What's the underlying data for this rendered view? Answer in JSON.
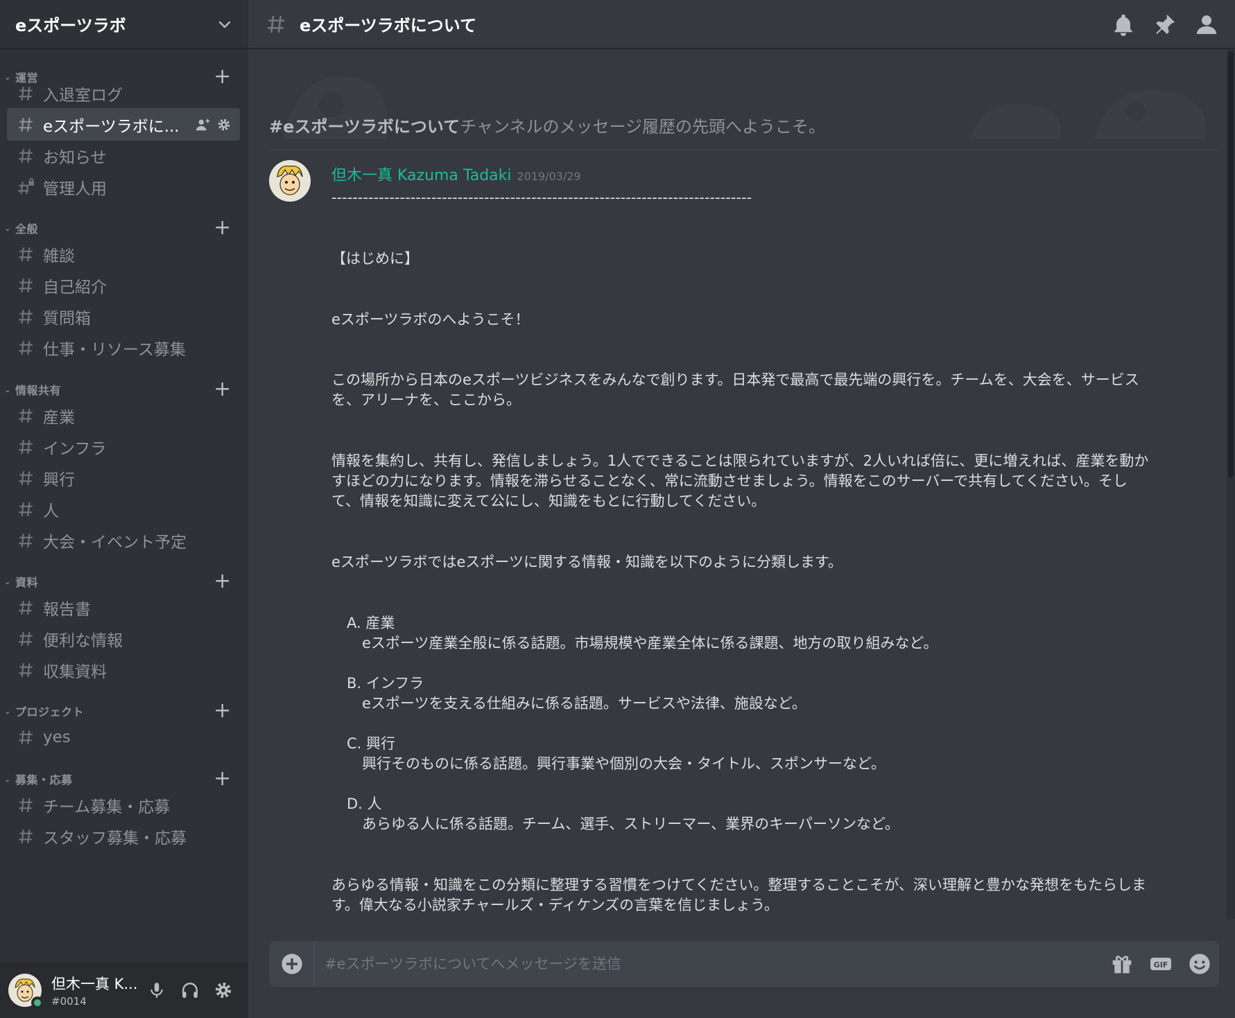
{
  "server": {
    "name": "eスポーツラボ",
    "dropdown_icon": "chevron-down-icon"
  },
  "categories": [
    {
      "label": "運営",
      "channels": [
        {
          "label": "入退室ログ",
          "icon": "hash-icon"
        },
        {
          "label": "eスポーツラボに...",
          "icon": "hash-icon",
          "selected": true
        },
        {
          "label": "お知らせ",
          "icon": "hash-icon"
        },
        {
          "label": "管理人用",
          "icon": "hash-lock-icon"
        }
      ]
    },
    {
      "label": "全般",
      "channels": [
        {
          "label": "雑談",
          "icon": "hash-icon"
        },
        {
          "label": "自己紹介",
          "icon": "hash-icon"
        },
        {
          "label": "質問箱",
          "icon": "hash-icon"
        },
        {
          "label": "仕事・リソース募集",
          "icon": "hash-icon"
        }
      ]
    },
    {
      "label": "情報共有",
      "channels": [
        {
          "label": "産業",
          "icon": "hash-icon"
        },
        {
          "label": "インフラ",
          "icon": "hash-icon"
        },
        {
          "label": "興行",
          "icon": "hash-icon"
        },
        {
          "label": "人",
          "icon": "hash-icon"
        },
        {
          "label": "大会・イベント予定",
          "icon": "hash-icon"
        }
      ]
    },
    {
      "label": "資料",
      "channels": [
        {
          "label": "報告書",
          "icon": "hash-icon"
        },
        {
          "label": "便利な情報",
          "icon": "hash-icon"
        },
        {
          "label": "収集資料",
          "icon": "hash-icon"
        }
      ]
    },
    {
      "label": "プロジェクト",
      "channels": [
        {
          "label": "yes",
          "icon": "hash-icon"
        }
      ]
    },
    {
      "label": "募集・応募",
      "channels": [
        {
          "label": "チーム募集・応募",
          "icon": "hash-icon"
        },
        {
          "label": "スタッフ募集・応募",
          "icon": "hash-icon"
        }
      ]
    }
  ],
  "user_panel": {
    "name": "但木一真 K...",
    "tag": "#0014",
    "status_color": "#43b581"
  },
  "topbar": {
    "channel_title": "eスポーツラボについて",
    "icons": [
      "bell-icon",
      "pin-icon",
      "members-icon"
    ]
  },
  "welcome": {
    "channel_bold": "#eスポーツラボについて",
    "rest": "チャンネルのメッセージ履歴の先頭へようこそ。"
  },
  "message": {
    "author": "但木一真 Kazuma Tadaki",
    "author_color": "#1abc9c",
    "date": "2019/03/29",
    "lines": {
      "divider": "--------------------------------------------------------------------------------",
      "intro_heading": "【はじめに】",
      "welcome": "eスポーツラボのへようこそ！",
      "p1_a": "この場所から日本のeスポーツビジネスをみんなで創ります。日本発で最高で最先端の興行を。チームを、大会を、サービス",
      "p1_b": "を、アリーナを、ここから。",
      "p2_a": "情報を集約し、共有し、発信しましょう。1人でできることは限られていますが、2人いれば倍に、更に増えれば、産業を動か",
      "p2_b": "すほどの力になります。情報を滞らせることなく、常に流動させましょう。情報をこのサーバーで共有してください。そし",
      "p2_c": "て、情報を知識に変えて公にし、知識をもとに行動してください。",
      "p3": "eスポーツラボではeスポーツに関する情報・知識を以下のように分類します。",
      "a_title": "A. 産業",
      "a_desc": "eスポーツ産業全般に係る話題。市場規模や産業全体に係る課題、地方の取り組みなど。",
      "b_title": "B. インフラ",
      "b_desc": "eスポーツを支える仕組みに係る話題。サービスや法律、施設など。",
      "c_title": "C. 興行",
      "c_desc": "興行そのものに係る話題。興行事業や個別の大会・タイトル、スポンサーなど。",
      "d_title": "D.  人",
      "d_desc": "あらゆる人に係る話題。チーム、選手、ストリーマー、業界のキーパーソンなど。",
      "p4_a": "あらゆる情報・知識をこの分類に整理する習慣をつけてください。整理することこそが、深い理解と豊かな発想をもたらしま",
      "p4_b": "す。偉大なる小説家チャールズ・ディケンズの言葉を信じましょう。"
    }
  },
  "composer": {
    "placeholder": "#eスポーツラボについてへメッセージを送信",
    "value": "",
    "icons": [
      "upload-plus-icon",
      "gift-icon",
      "gif-icon",
      "emoji-icon"
    ]
  },
  "colors": {
    "sidebar_bg": "#2f3136",
    "main_bg": "#36393f",
    "selected_channel_bg": "#42464d",
    "composer_bg": "#40444b"
  }
}
